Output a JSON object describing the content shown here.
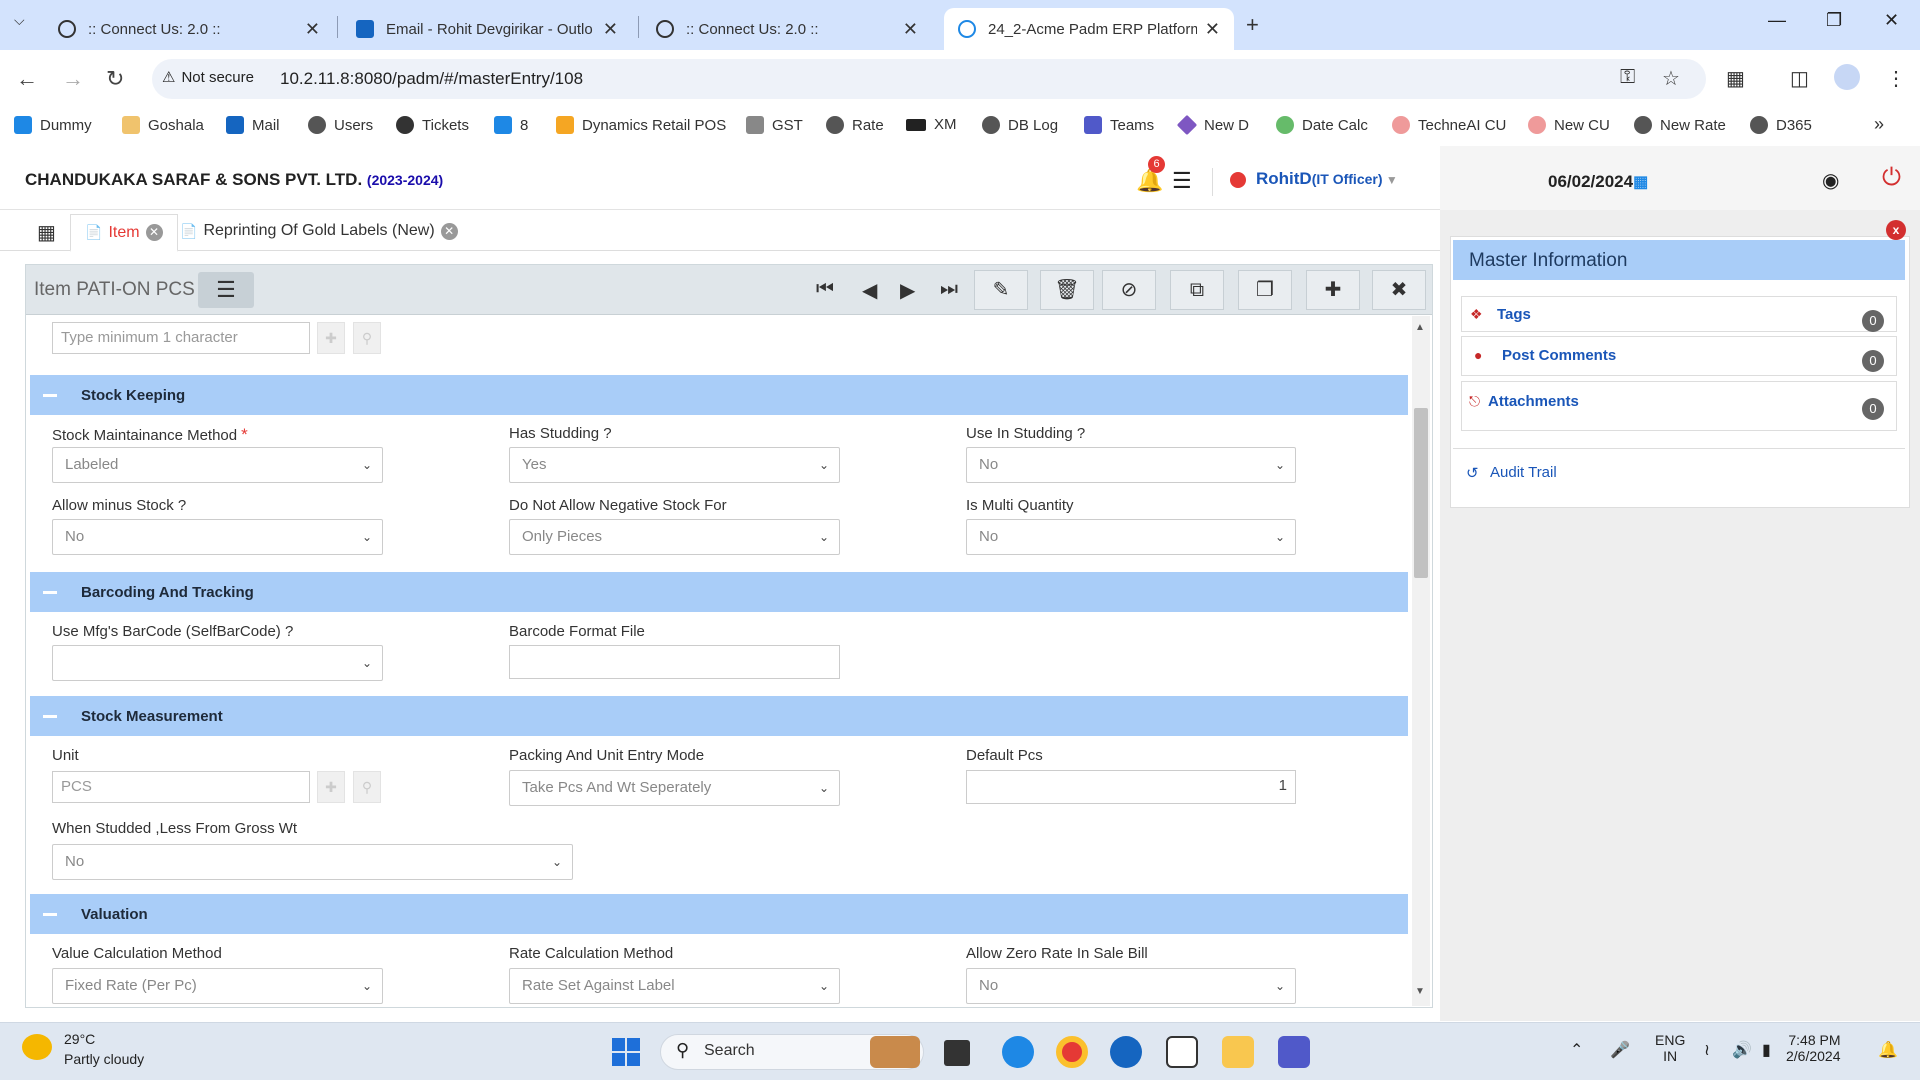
{
  "browser": {
    "tabs": [
      {
        "title": ":: Connect Us: 2.0 ::"
      },
      {
        "title": "Email - Rohit Devgirikar - Outlo"
      },
      {
        "title": ":: Connect Us: 2.0 ::"
      },
      {
        "title": "24_2-Acme Padm ERP Platform"
      }
    ],
    "not_secure": "Not secure",
    "url": "10.2.11.8:8080/padm/#/masterEntry/108",
    "bookmarks": [
      "Dummy",
      "Goshala",
      "Mail",
      "Users",
      "Tickets",
      "8",
      "Dynamics Retail POS",
      "GST",
      "Rate",
      "XM",
      "DB Log",
      "Teams",
      "New D",
      "Date Calc",
      "TechneAI CU",
      "New CU",
      "New Rate",
      "D365"
    ]
  },
  "header": {
    "company": "CHANDUKAKA SARAF & SONS PVT. LTD.",
    "year": "(2023-2024)",
    "notifications": "6",
    "user": "RohitD",
    "role": "(IT Officer)",
    "date": "06/02/2024"
  },
  "tabs": {
    "item": "Item",
    "reprint": "Reprinting Of Gold Labels (New)"
  },
  "form": {
    "title": "Item PATI-ON PCS",
    "search_placeholder": "Type minimum 1 character",
    "sections": {
      "stock_keeping": "Stock Keeping",
      "barcoding": "Barcoding And Tracking",
      "measurement": "Stock Measurement",
      "valuation": "Valuation"
    },
    "fields": {
      "stock_method": {
        "label": "Stock Maintainance Method",
        "value": "Labeled"
      },
      "has_studding": {
        "label": "Has Studding ?",
        "value": "Yes"
      },
      "use_in_studding": {
        "label": "Use In Studding ?",
        "value": "No"
      },
      "allow_minus": {
        "label": "Allow minus Stock ?",
        "value": "No"
      },
      "no_negative_for": {
        "label": "Do Not Allow Negative Stock For",
        "value": "Only Pieces"
      },
      "multi_qty": {
        "label": "Is Multi Quantity",
        "value": "No"
      },
      "mfg_barcode": {
        "label": "Use Mfg's BarCode (SelfBarCode) ?",
        "value": ""
      },
      "barcode_file": {
        "label": "Barcode Format File",
        "value": ""
      },
      "unit": {
        "label": "Unit",
        "value": "PCS"
      },
      "packing_mode": {
        "label": "Packing And Unit Entry Mode",
        "value": "Take Pcs And Wt Seperately"
      },
      "default_pcs": {
        "label": "Default Pcs",
        "value": "1"
      },
      "studded_less": {
        "label": "When Studded ,Less From Gross Wt",
        "value": "No"
      },
      "value_calc": {
        "label": "Value Calculation Method",
        "value": "Fixed Rate (Per Pc)"
      },
      "rate_calc": {
        "label": "Rate Calculation Method",
        "value": "Rate Set Against Label"
      },
      "zero_rate": {
        "label": "Allow Zero Rate In Sale Bill",
        "value": "No"
      }
    }
  },
  "master_info": {
    "title": "Master Information",
    "tags": {
      "label": "Tags",
      "count": "0"
    },
    "comments": {
      "label": "Post Comments",
      "count": "0"
    },
    "attachments": {
      "label": "Attachments",
      "count": "0"
    },
    "audit": "Audit Trail",
    "close": "x"
  },
  "taskbar": {
    "temp": "29°C",
    "condition": "Partly cloudy",
    "search": "Search",
    "lang1": "ENG",
    "lang2": "IN",
    "time": "7:48 PM",
    "date": "2/6/2024"
  }
}
